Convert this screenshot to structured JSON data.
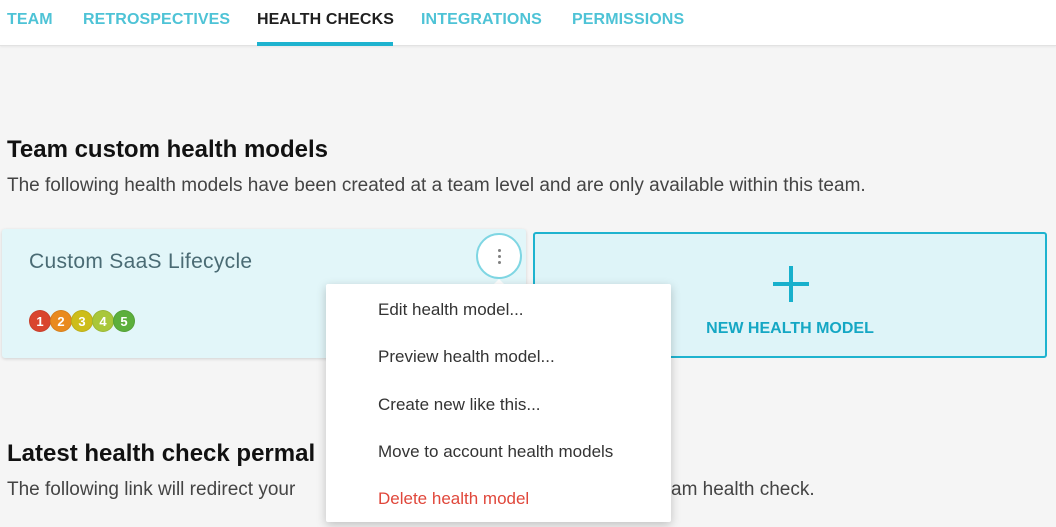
{
  "tabs": [
    {
      "label": "TEAM"
    },
    {
      "label": "RETROSPECTIVES"
    },
    {
      "label": "HEALTH CHECKS",
      "active": true
    },
    {
      "label": "INTEGRATIONS"
    },
    {
      "label": "PERMISSIONS"
    }
  ],
  "custom_models": {
    "heading": "Team custom health models",
    "description": "The following health models have been created at a team level and are only available within this team.",
    "card": {
      "title": "Custom SaaS Lifecycle",
      "scale": [
        {
          "label": "1",
          "color": "#d9442e"
        },
        {
          "label": "2",
          "color": "#e98a1e"
        },
        {
          "label": "3",
          "color": "#cdbd1a"
        },
        {
          "label": "4",
          "color": "#a9c73a"
        },
        {
          "label": "5",
          "color": "#5caf3c"
        }
      ],
      "menu_icon": "kebab-menu-icon"
    },
    "new_card": {
      "label": "NEW HEALTH MODEL",
      "icon": "plus-icon"
    }
  },
  "dropdown": {
    "items": [
      {
        "label": "Edit health model..."
      },
      {
        "label": "Preview health model..."
      },
      {
        "label": "Create new like this..."
      },
      {
        "label": "Move to account health models"
      },
      {
        "label": "Delete health model",
        "danger_color": "#e0473b"
      }
    ]
  },
  "permalink": {
    "heading_visible": "Latest health check permal",
    "description_left": "The following link will redirect your",
    "description_right": "am health check."
  },
  "colors": {
    "accent": "#1eb3cf",
    "tab": "#4ec3d6",
    "card_bg": "#e2f6f9"
  }
}
